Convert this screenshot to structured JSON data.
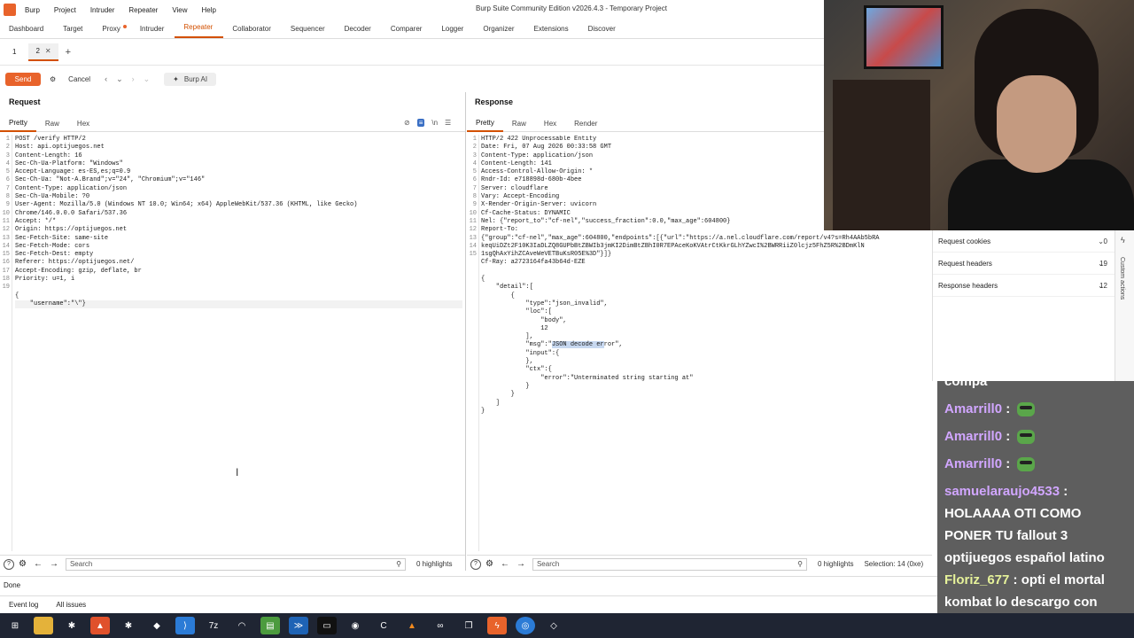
{
  "menu": [
    "Burp",
    "Project",
    "Intruder",
    "Repeater",
    "View",
    "Help"
  ],
  "window_title": "Burp Suite Community Edition v2026.4.3 - Temporary Project",
  "tool_tabs": [
    {
      "label": "Dashboard"
    },
    {
      "label": "Target"
    },
    {
      "label": "Proxy",
      "dot": true
    },
    {
      "label": "Intruder"
    },
    {
      "label": "Repeater",
      "active": true
    },
    {
      "label": "Collaborator"
    },
    {
      "label": "Sequencer"
    },
    {
      "label": "Decoder"
    },
    {
      "label": "Comparer"
    },
    {
      "label": "Logger"
    },
    {
      "label": "Organizer"
    },
    {
      "label": "Extensions"
    },
    {
      "label": "Discover"
    }
  ],
  "repeater_tabs": [
    "1",
    "2"
  ],
  "toolbar": {
    "send": "Send",
    "cancel": "Cancel",
    "burp_ai": "Burp AI"
  },
  "request": {
    "title": "Request",
    "tabs": [
      "Pretty",
      "Raw",
      "Hex"
    ],
    "lines": [
      "POST /verify HTTP/2",
      "Host: api.optijuegos.net",
      "Content-Length: 16",
      "Sec-Ch-Ua-Platform: \"Windows\"",
      "Accept-Language: es-ES,es;q=0.9",
      "Sec-Ch-Ua: \"Not-A.Brand\";v=\"24\", \"Chromium\";v=\"146\"",
      "Content-Type: application/json",
      "Sec-Ch-Ua-Mobile: ?0",
      "User-Agent: Mozilla/5.0 (Windows NT 10.0; Win64; x64) AppleWebKit/537.36 (KHTML, like Gecko)",
      "Chrome/146.0.0.0 Safari/537.36",
      "Accept: */*",
      "Origin: https://optijuegos.net",
      "Sec-Fetch-Site: same-site",
      "Sec-Fetch-Mode: cors",
      "Sec-Fetch-Dest: empty",
      "Referer: https://optijuegos.net/",
      "Accept-Encoding: gzip, deflate, br",
      "Priority: u=1, i",
      "",
      "{",
      "    \"username\":\"\\\"}"
    ],
    "line_numbers": [
      "1",
      "2",
      "3",
      "4",
      "5",
      "6",
      "7",
      "8",
      "9",
      "",
      "10",
      "11",
      "12",
      "13",
      "14",
      "15",
      "16",
      "17",
      "18",
      "19",
      ""
    ],
    "search_placeholder": "Search",
    "highlights": "0 highlights"
  },
  "response": {
    "title": "Response",
    "tabs": [
      "Pretty",
      "Raw",
      "Hex",
      "Render"
    ],
    "lines": [
      "HTTP/2 422 Unprocessable Entity",
      "Date: Fri, 07 Aug 2026 00:33:58 GMT",
      "Content-Type: application/json",
      "Content-Length: 141",
      "Access-Control-Allow-Origin: *",
      "Rndr-Id: e718898d-680b-4bee",
      "Server: cloudflare",
      "Vary: Accept-Encoding",
      "X-Render-Origin-Server: uvicorn",
      "Cf-Cache-Status: DYNAMIC",
      "Nel: {\"report_to\":\"cf-nel\",\"success_fraction\":0.0,\"max_age\":604800}",
      "Report-To:",
      "{\"group\":\"cf-nel\",\"max_age\":604800,\"endpoints\":[{\"url\":\"https://a.nel.cloudflare.com/report/v4?s=Rh4AAb5bRA",
      "keqUiDZt2F10K3IaDLZQ8GUPbBtZBWIb3jmKI2DimBtZBhI0R7EPAceKoKVAtrCtKkrGLhYZwcI%2BWRRiiZ0lcjz5FhZ5R%2BDmKlN",
      "1sgQhAxYihZCAveWeVETBuKsR05E%3D\"}]}",
      "Cf-Ray: a2723164fa43b64d-EZE",
      "",
      "{",
      "    \"detail\":[",
      "        {",
      "            \"type\":\"json_invalid\",",
      "            \"loc\":[",
      "                \"body\",",
      "                12",
      "            ],",
      "            \"msg\":\"JSON decode error\",",
      "            \"input\":{",
      "            },",
      "            \"ctx\":{",
      "                \"error\":\"Unterminated string starting at\"",
      "            }",
      "        }",
      "    ]",
      "}"
    ],
    "line_numbers": [
      "1",
      "2",
      "3",
      "4",
      "5",
      "6",
      "7",
      "8",
      "9",
      "10",
      "11",
      "12",
      "",
      "",
      "",
      "13",
      "14",
      "15",
      "",
      "",
      "",
      "",
      "",
      "",
      "",
      "",
      "",
      "",
      "",
      "",
      "",
      "",
      "",
      ""
    ],
    "search_placeholder": "Search",
    "highlights": "0 highlights",
    "selection": "Selection: 14 (0xe)"
  },
  "inspector": [
    {
      "label": "Request cookies",
      "count": "0"
    },
    {
      "label": "Request headers",
      "count": "19"
    },
    {
      "label": "Response headers",
      "count": "12"
    }
  ],
  "side_actions_label": "Custom actions",
  "chat": [
    {
      "text": "compa"
    },
    {
      "name": "Amarrill0",
      "emote": true
    },
    {
      "name": "Amarrill0",
      "emote": true
    },
    {
      "name": "Amarrill0",
      "emote": true
    },
    {
      "name": "samuelaraujo4533",
      "text": "HOLAAAA OTI COMO PONER TU fallout 3 optijuegos español latino"
    },
    {
      "name": "Floriz_677",
      "green": true,
      "text": "opti el mortal kombat lo descargo con mediafire o con otro?"
    }
  ],
  "status": {
    "done": "Done",
    "event_log": "Event log",
    "all_issues": "All issues"
  }
}
